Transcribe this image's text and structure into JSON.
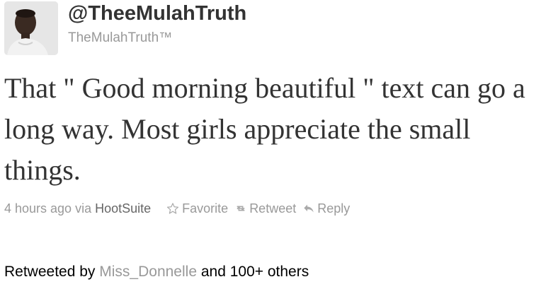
{
  "tweet": {
    "screen_name": "@TheeMulahTruth",
    "full_name": "TheMulahTruth™",
    "text": "That \" Good morning beautiful \" text can go a long way. Most girls appreciate the small things.",
    "timestamp": "4 hours ago",
    "via_prefix": "via",
    "source": "HootSuite"
  },
  "actions": {
    "favorite_label": "Favorite",
    "retweet_label": "Retweet",
    "reply_label": "Reply",
    "favorite_icon": "star-icon",
    "retweet_icon": "retweet-icon",
    "reply_icon": "reply-icon"
  },
  "retweeted": {
    "prefix": "Retweeted by",
    "user": "Miss_Donnelle",
    "suffix": "and 100+ others"
  },
  "colors": {
    "primary_text": "#333333",
    "muted_text": "#999999"
  }
}
